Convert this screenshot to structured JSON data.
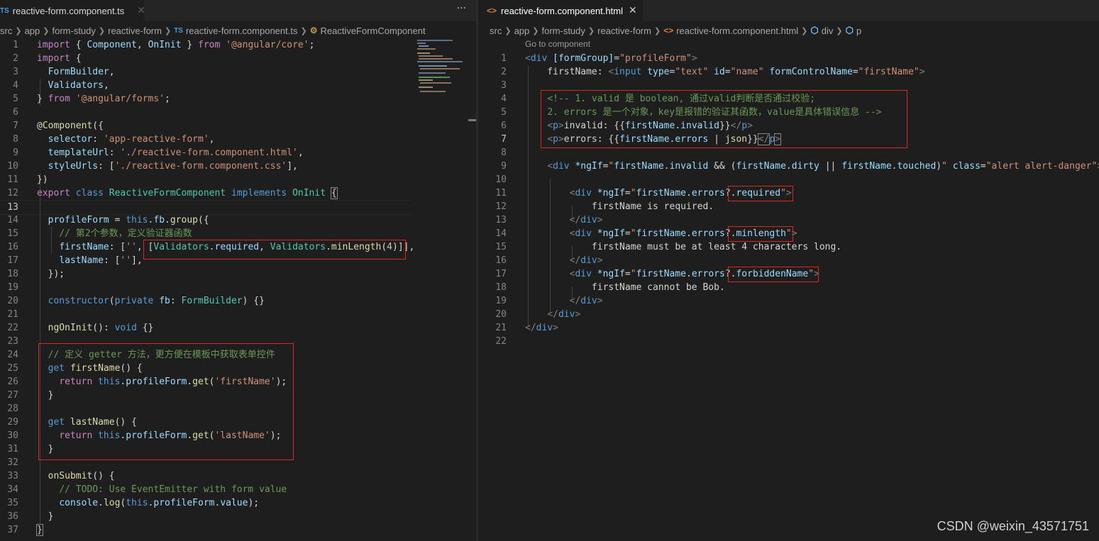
{
  "left": {
    "tab": {
      "icon": "TS",
      "label": "reactive-form.component.ts",
      "more": "···"
    },
    "breadcrumb": {
      "items": [
        "src",
        "app",
        "form-study",
        "reactive-form"
      ],
      "file_icon": "TS",
      "file": "reactive-form.component.ts",
      "symbol": "ReactiveFormComponent"
    },
    "line_numbers": [
      "1",
      "2",
      "3",
      "4",
      "5",
      "6",
      "7",
      "8",
      "9",
      "10",
      "11",
      "12",
      "13",
      "14",
      "15",
      "16",
      "17",
      "18",
      "19",
      "20",
      "21",
      "22",
      "23",
      "24",
      "25",
      "26",
      "27",
      "28",
      "29",
      "30",
      "31",
      "32",
      "33",
      "34",
      "35",
      "36",
      "37"
    ]
  },
  "right": {
    "tab": {
      "icon": "<>",
      "label": "reactive-form.component.html",
      "close": "✕"
    },
    "breadcrumb": {
      "items": [
        "src",
        "app",
        "form-study",
        "reactive-form"
      ],
      "file_icon": "<>",
      "file": "reactive-form.component.html",
      "sym1": "div",
      "sym2": "p"
    },
    "codelens": "Go to component",
    "line_numbers": [
      "1",
      "2",
      "3",
      "4",
      "5",
      "6",
      "7",
      "8",
      "9",
      "10",
      "11",
      "12",
      "13",
      "14",
      "15",
      "16",
      "17",
      "18",
      "19",
      "20",
      "21",
      "22"
    ]
  },
  "watermark": "CSDN @weixin_43571751",
  "colors": {
    "background": "#1e1e1e",
    "highlight_box": "#e02424",
    "keyword": "#569cd6",
    "string": "#ce9178",
    "comment": "#6a9955"
  }
}
